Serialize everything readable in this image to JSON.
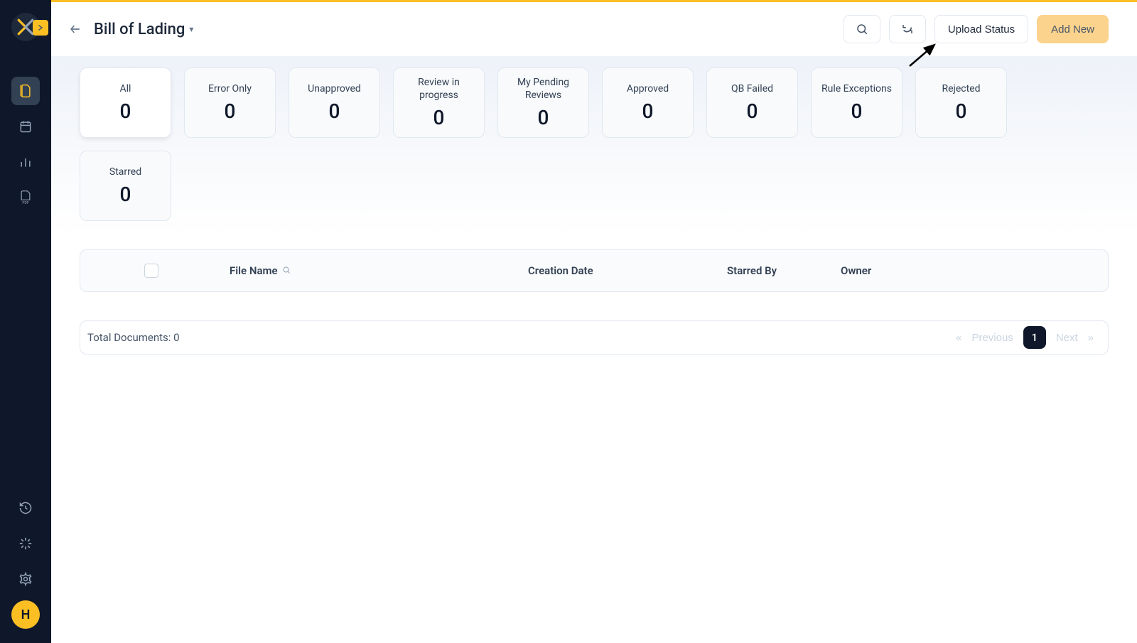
{
  "header": {
    "title": "Bill of Lading",
    "upload_status_label": "Upload Status",
    "add_new_label": "Add New"
  },
  "sidebar": {
    "avatar_letter": "H"
  },
  "filters": [
    {
      "label": "All",
      "count": "0",
      "active": true
    },
    {
      "label": "Error Only",
      "count": "0",
      "active": false
    },
    {
      "label": "Unapproved",
      "count": "0",
      "active": false
    },
    {
      "label": "Review in progress",
      "count": "0",
      "active": false
    },
    {
      "label": "My Pending Reviews",
      "count": "0",
      "active": false
    },
    {
      "label": "Approved",
      "count": "0",
      "active": false
    },
    {
      "label": "QB Failed",
      "count": "0",
      "active": false
    },
    {
      "label": "Rule Exceptions",
      "count": "0",
      "active": false
    },
    {
      "label": "Rejected",
      "count": "0",
      "active": false
    },
    {
      "label": "Starred",
      "count": "0",
      "active": false
    }
  ],
  "table": {
    "columns": {
      "file_name": "File Name",
      "creation_date": "Creation Date",
      "starred_by": "Starred By",
      "owner": "Owner"
    }
  },
  "footer": {
    "total_label": "Total Documents: 0",
    "previous_label": "Previous",
    "next_label": "Next",
    "current_page": "1"
  }
}
